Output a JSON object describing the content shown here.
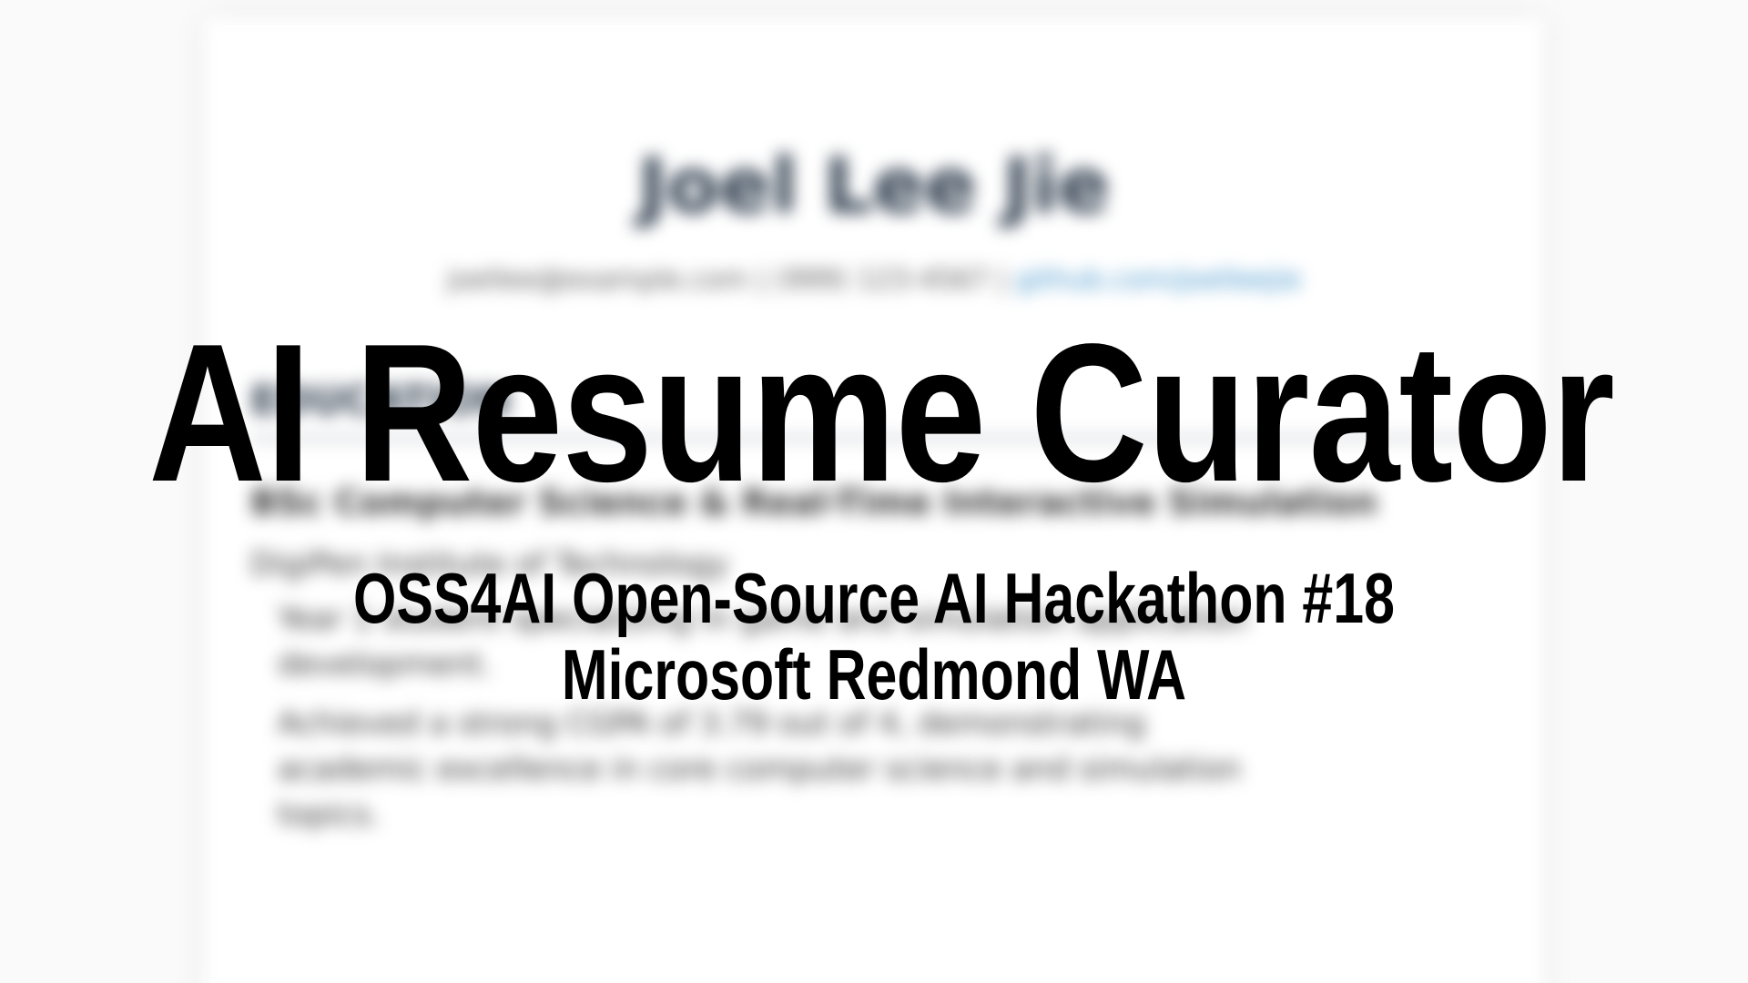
{
  "background_resume": {
    "name": "Joel Lee Jie",
    "contact": "joellee@example.com | (999) 123-4567 | ",
    "link": "github.com/joelleejie",
    "section_title": "EDUCATION",
    "lines": [
      "BSc Computer Science & Real-Time Interactive Simulation",
      "DigiPen Institute of Technology"
    ],
    "bullets": [
      "Year 1 student specializing in game and simulation application",
      "development.",
      "Achieved a strong CGPA of 3.79 out of 4, demonstrating",
      "academic excellence in core computer science and simulation",
      "topics."
    ]
  },
  "overlay": {
    "title": "AI Resume Curator",
    "subtitle_line1": "OSS4AI Open-Source AI Hackathon #18",
    "subtitle_line2": "Microsoft Redmond WA"
  }
}
